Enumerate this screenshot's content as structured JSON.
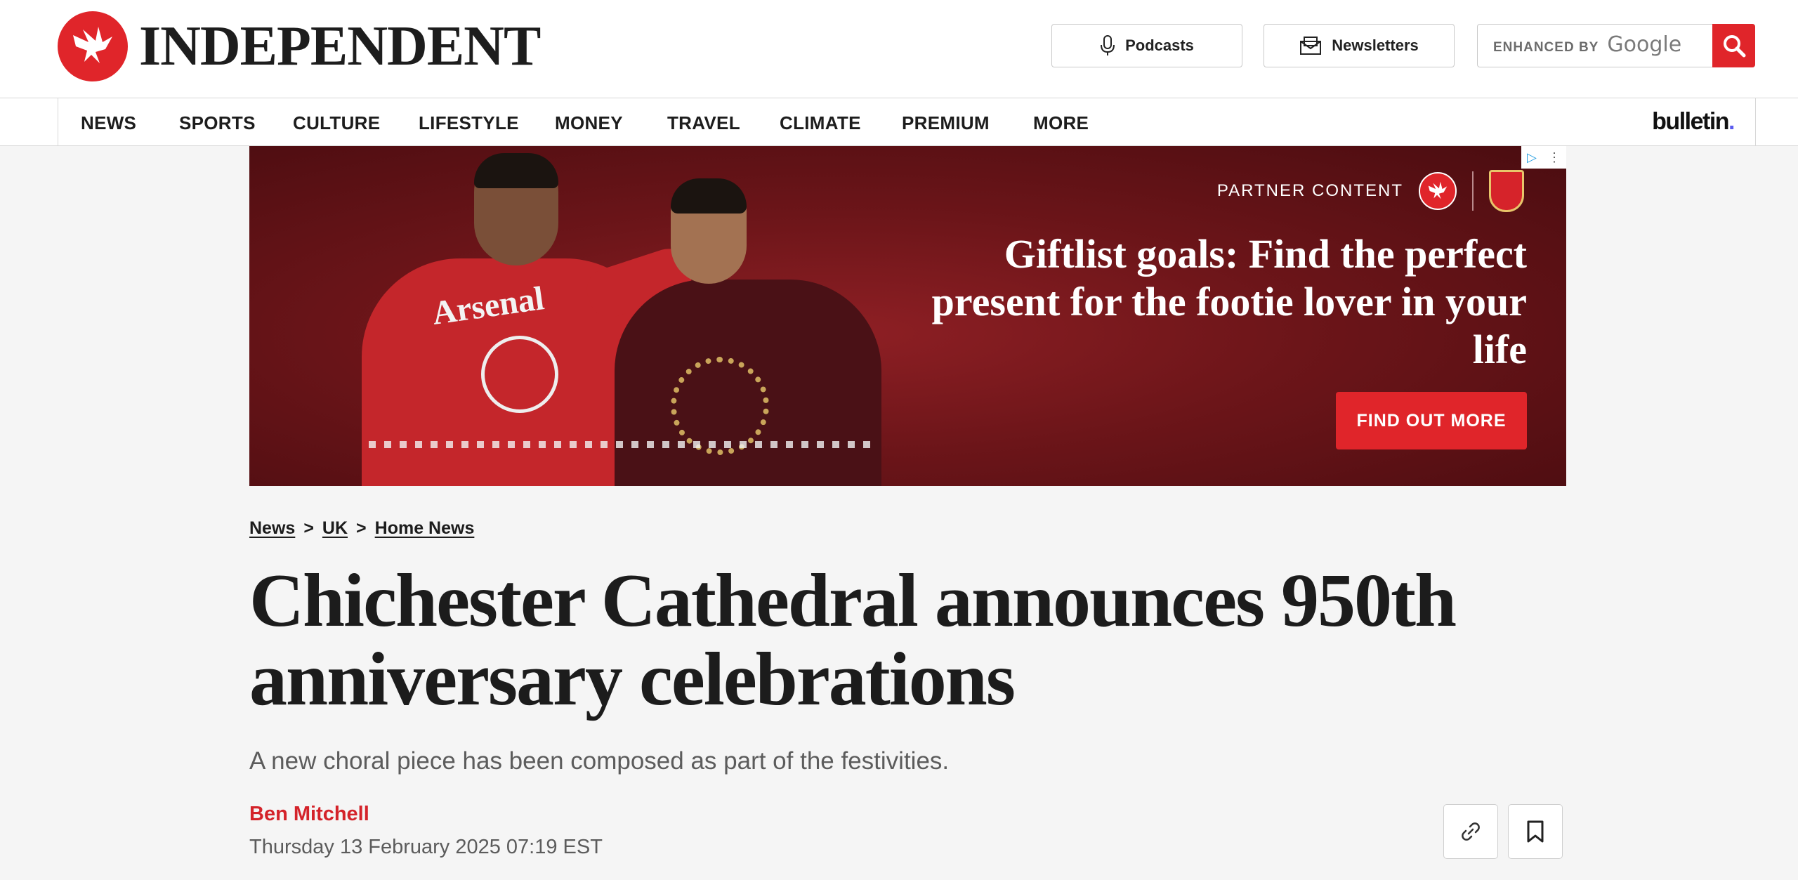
{
  "header": {
    "logo_text": "INDEPENDENT",
    "podcasts_label": "Podcasts",
    "newsletters_label": "Newsletters",
    "search": {
      "enhanced_label": "ENHANCED BY",
      "google_label": "Google"
    }
  },
  "nav": {
    "items": [
      "NEWS",
      "SPORTS",
      "CULTURE",
      "LIFESTYLE",
      "MONEY",
      "TRAVEL",
      "CLIMATE",
      "PREMIUM",
      "MORE"
    ],
    "bulletin_label": "bulletin",
    "bulletin_dot": "."
  },
  "ad": {
    "partner_label": "PARTNER CONTENT",
    "headline": "Giftlist goals: Find the perfect present for the footie lover in your life",
    "cta_label": "FIND OUT MORE",
    "sweater_text": "Arsenal"
  },
  "breadcrumb": {
    "items": [
      "News",
      "UK",
      "Home News"
    ],
    "separator": ">"
  },
  "article": {
    "headline": "Chichester Cathedral announces 950th anniversary celebrations",
    "subheadline": "A new choral piece has been composed as part of the festivities.",
    "author": "Ben Mitchell",
    "date": "Thursday 13 February 2025 07:19 EST"
  },
  "colors": {
    "brand_red": "#e0252a",
    "author_red": "#d4232a",
    "ad_background": "#6c1519"
  }
}
